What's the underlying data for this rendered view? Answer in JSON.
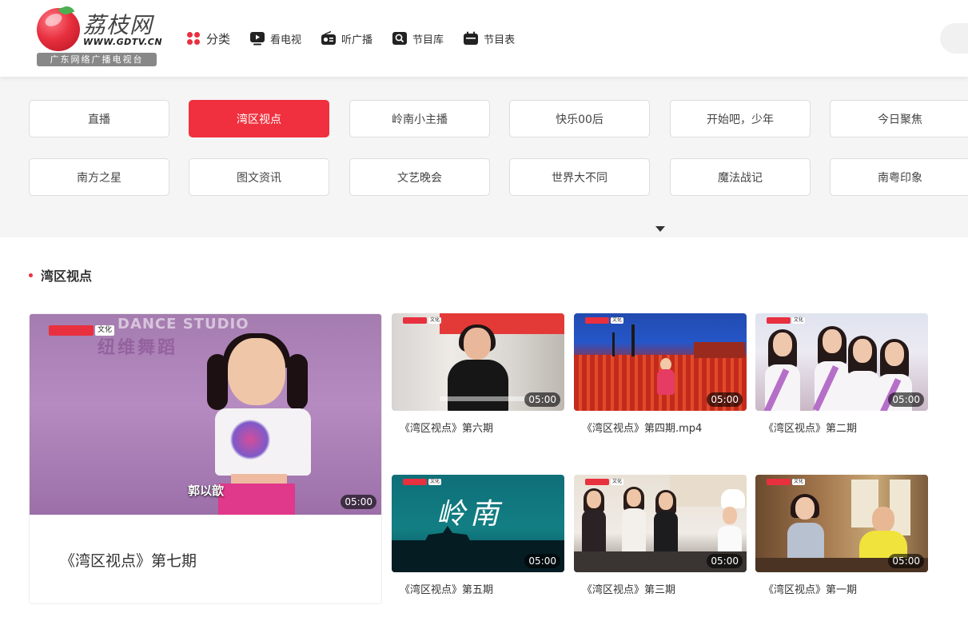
{
  "logo": {
    "title": "荔枝网",
    "url": "WWW.GDTV.CN",
    "tagline": "广东网络广播电视台"
  },
  "nav": [
    {
      "icon": "category-dots-icon",
      "label": "分类"
    },
    {
      "icon": "play-tv-icon",
      "label": "看电视"
    },
    {
      "icon": "radio-icon",
      "label": "听广播"
    },
    {
      "icon": "program-library-icon",
      "label": "节目库"
    },
    {
      "icon": "calendar-icon",
      "label": "节目表"
    }
  ],
  "categories": [
    {
      "label": "直播",
      "active": false
    },
    {
      "label": "湾区视点",
      "active": true
    },
    {
      "label": "岭南小主播",
      "active": false
    },
    {
      "label": "快乐00后",
      "active": false
    },
    {
      "label": "开始吧，少年",
      "active": false
    },
    {
      "label": "今日聚焦",
      "active": false
    },
    {
      "label": "南方之星",
      "active": false
    },
    {
      "label": "图文资讯",
      "active": false
    },
    {
      "label": "文艺晚会",
      "active": false
    },
    {
      "label": "世界大不同",
      "active": false
    },
    {
      "label": "魔法战记",
      "active": false
    },
    {
      "label": "南粤印象",
      "active": false
    }
  ],
  "section": {
    "title": "湾区视点"
  },
  "featured": {
    "caption": "《湾区视点》第七期",
    "duration": "05:00",
    "badge": "文化",
    "studio_text": "DANCE STUDIO",
    "studio_cn": "纽维舞蹈",
    "subtitle_name": "郭以歆"
  },
  "videos": [
    {
      "caption": "《湾区视点》第六期",
      "duration": "05:00",
      "badge": "文化"
    },
    {
      "caption": "《湾区视点》第四期.mp4",
      "duration": "05:00",
      "badge": "文化"
    },
    {
      "caption": "《湾区视点》第二期",
      "duration": "05:00",
      "badge": "文化"
    },
    {
      "caption": "《湾区视点》第五期",
      "duration": "05:00",
      "badge": "文化",
      "thumb_title": "岭南"
    },
    {
      "caption": "《湾区视点》第三期",
      "duration": "05:00",
      "badge": "文化"
    },
    {
      "caption": "《湾区视点》第一期",
      "duration": "05:00",
      "badge": "文化"
    }
  ],
  "colors": {
    "accent": "#f0303e",
    "panel": "#f5f5f5"
  }
}
